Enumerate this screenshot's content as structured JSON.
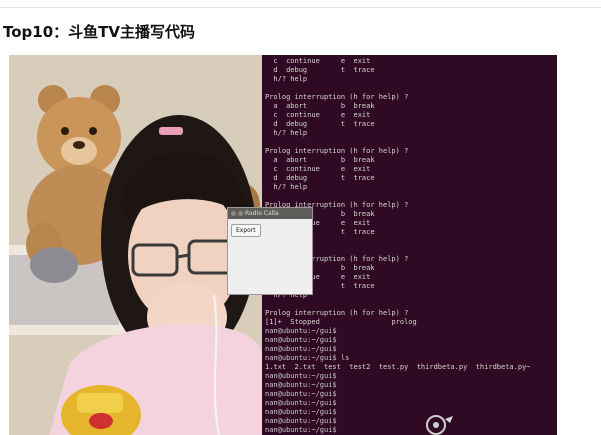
{
  "article": {
    "heading": "Top10：斗鱼TV主播写代码"
  },
  "photo": {
    "terminal_lines": [
      "  c  continue     e  exit",
      "  d  debug        t  trace",
      "  h/? help",
      "",
      "Prolog interruption (h for help) ?",
      "  a  abort        b  break",
      "  c  continue     e  exit",
      "  d  debug        t  trace",
      "  h/? help",
      "",
      "Prolog interruption (h for help) ?",
      "  a  abort        b  break",
      "  c  continue     e  exit",
      "  d  debug        t  trace",
      "  h/? help",
      "",
      "Prolog interruption (h for help) ?",
      "  a  abort        b  break",
      "  c  continue     e  exit",
      "  d  debug        t  trace",
      "  h/? help",
      "",
      "Prolog interruption (h for help) ?",
      "  a  abort        b  break",
      "  c  continue     e  exit",
      "  d  debug        t  trace",
      "  h/? help",
      "",
      "Prolog interruption (h for help) ?",
      "[1]+  Stopped                 prolog",
      "nan@ubuntu:~/gui$",
      "nan@ubuntu:~/gui$",
      "nan@ubuntu:~/gui$",
      "nan@ubuntu:~/gui$ ls",
      "1.txt  2.txt  test  test2  test.py  thirdbeta.py  thirdbeta.py~",
      "nan@ubuntu:~/gui$",
      "nan@ubuntu:~/gui$",
      "nan@ubuntu:~/gui$",
      "nan@ubuntu:~/gui$",
      "nan@ubuntu:~/gui$",
      "nan@ubuntu:~/gui$",
      "nan@ubuntu:~/gui$"
    ],
    "dialog": {
      "title": "Radio Calla",
      "button": "Export"
    }
  }
}
